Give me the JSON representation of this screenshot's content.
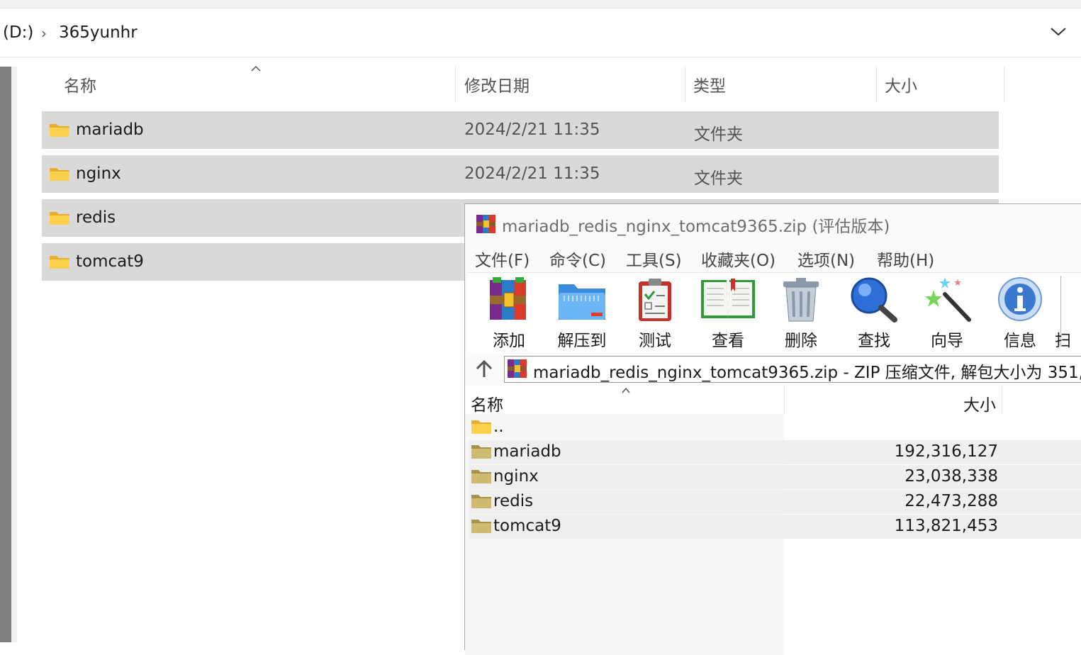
{
  "address": {
    "drive": "(D:)",
    "separator": "›",
    "folder": "365yunhr"
  },
  "explorer": {
    "columns": [
      "名称",
      "修改日期",
      "类型",
      "大小"
    ],
    "rows": [
      {
        "name": "mariadb",
        "date": "2024/2/21 11:35",
        "type": "文件夹"
      },
      {
        "name": "nginx",
        "date": "2024/2/21 11:35",
        "type": "文件夹"
      },
      {
        "name": "redis",
        "date": "",
        "type": ""
      },
      {
        "name": "tomcat9",
        "date": "",
        "type": ""
      }
    ]
  },
  "winrar": {
    "title": "mariadb_redis_nginx_tomcat9365.zip (评估版本)",
    "menu": [
      "文件(F)",
      "命令(C)",
      "工具(S)",
      "收藏夹(O)",
      "选项(N)",
      "帮助(H)"
    ],
    "toolbar": [
      "添加",
      "解压到",
      "测试",
      "查看",
      "删除",
      "查找",
      "向导",
      "信息",
      "扫"
    ],
    "path_text": "mariadb_redis_nginx_tomcat9365.zip - ZIP 压缩文件, 解包大小为 351,(",
    "columns": [
      "名称",
      "大小"
    ],
    "rows": [
      {
        "name": "..",
        "size": ""
      },
      {
        "name": "mariadb",
        "size": "192,316,127"
      },
      {
        "name": "nginx",
        "size": "23,038,338"
      },
      {
        "name": "redis",
        "size": "22,473,288"
      },
      {
        "name": "tomcat9",
        "size": "113,821,453"
      }
    ]
  },
  "colors": {
    "selected_row": "#d9d9d9",
    "folder_yellow": "#f8c83a",
    "rar_folder": "#c8b56a"
  }
}
